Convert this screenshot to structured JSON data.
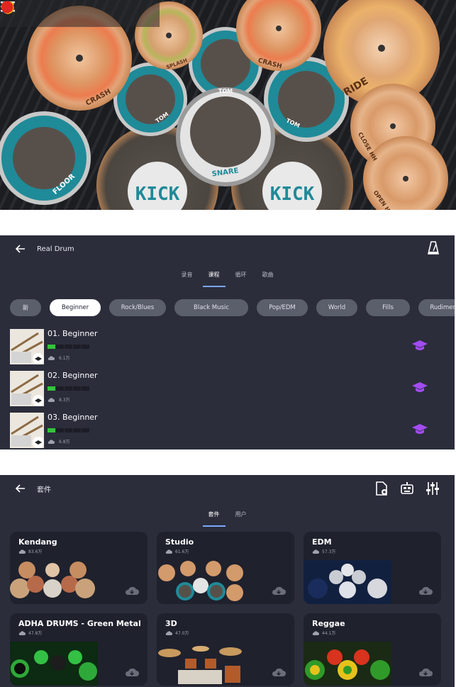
{
  "kit": {
    "toolbar": [
      "menu-icon",
      "loop-icon",
      "shirt-icon",
      "play-icon",
      "record-icon"
    ],
    "pads": {
      "crash_left": "CRASH",
      "splash": "SPLASH",
      "crash_right": "CRASH",
      "ride": "RIDE",
      "tom1": "TOM",
      "tom2": "TOM",
      "tom3": "TOM",
      "snare": "SNARE",
      "floor": "FLOOR",
      "kick_left": "KICK",
      "kick_right": "KICK",
      "close_hh": "CLOSE HH",
      "open_hh": "OPEN HH"
    },
    "colors": {
      "cymbal": "#d39a6b",
      "drum_rim": "#1f8a98",
      "pad": "#57504a"
    }
  },
  "lessons": {
    "title": "Real Drum",
    "tabs": [
      {
        "label": "录音",
        "active": false
      },
      {
        "label": "课程",
        "active": true
      },
      {
        "label": "循环",
        "active": false
      },
      {
        "label": "歌曲",
        "active": false
      }
    ],
    "chips": [
      {
        "label": "新",
        "active": false
      },
      {
        "label": "Beginner",
        "active": true
      },
      {
        "label": "Rock/Blues",
        "active": false
      },
      {
        "label": "Black Music",
        "active": false
      },
      {
        "label": "Pop/EDM",
        "active": false
      },
      {
        "label": "World",
        "active": false
      },
      {
        "label": "Fills",
        "active": false
      },
      {
        "label": "Rudiments",
        "active": false
      }
    ],
    "items": [
      {
        "name": "01. Beginner",
        "progress": 0.2,
        "downloads": "6.1万"
      },
      {
        "name": "02. Beginner",
        "progress": 0.2,
        "downloads": "8.3万"
      },
      {
        "name": "03. Beginner",
        "progress": 0.2,
        "downloads": "6.8万"
      }
    ],
    "accent": "#a24cf2"
  },
  "kits": {
    "title": "套件",
    "tabs": [
      {
        "label": "套件",
        "active": true
      },
      {
        "label": "用户",
        "active": false
      }
    ],
    "cards": [
      {
        "name": "Kendang",
        "downloads": "83.6万",
        "theme": "kendang"
      },
      {
        "name": "Studio",
        "downloads": "61.6万",
        "theme": "studio"
      },
      {
        "name": "EDM",
        "downloads": "57.3万",
        "theme": "edm"
      },
      {
        "name": "ADHA DRUMS - Green Metal",
        "downloads": "47.8万",
        "theme": "green"
      },
      {
        "name": "3D",
        "downloads": "47.0万",
        "theme": "3d"
      },
      {
        "name": "Reggae",
        "downloads": "44.1万",
        "theme": "reggae"
      }
    ]
  }
}
